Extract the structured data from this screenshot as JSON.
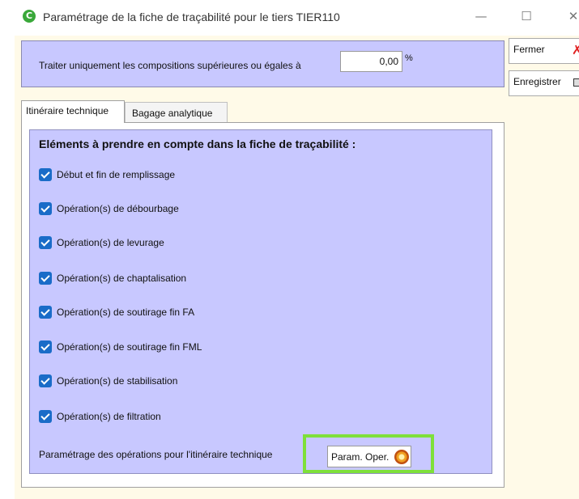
{
  "window": {
    "title": "Paramétrage de la fiche de traçabilité pour le tiers TIER110",
    "minimize": "—",
    "maximize": "☐",
    "close": "✕"
  },
  "threshold": {
    "label": "Traiter uniquement les compositions supérieures ou égales à",
    "value": "0,00",
    "unit": "%"
  },
  "buttons": {
    "close_label": "Fermer",
    "save_label": "Enregistrer",
    "close_icon": "x-icon",
    "save_icon": "save-icon"
  },
  "tabs": [
    {
      "label": "Itinéraire technique",
      "active": true
    },
    {
      "label": "Bagage analytique",
      "active": false
    }
  ],
  "section": {
    "title": "Eléments à prendre en compte dans la fiche de traçabilité :",
    "items": [
      {
        "label": "Début et fin de remplissage",
        "checked": true
      },
      {
        "label": "Opération(s)  de débourbage",
        "checked": true
      },
      {
        "label": "Opération(s)  de levurage",
        "checked": true
      },
      {
        "label": "Opération(s)  de chaptalisation",
        "checked": true
      },
      {
        "label": "Opération(s)  de soutirage fin FA",
        "checked": true
      },
      {
        "label": "Opération(s)  de soutirage fin FML",
        "checked": true
      },
      {
        "label": "Opération(s)  de stabilisation",
        "checked": true
      },
      {
        "label": "Opération(s)  de filtration",
        "checked": true
      }
    ]
  },
  "param": {
    "label": "Paramétrage des opérations pour l'itinéraire technique",
    "button_label": "Param. Oper.",
    "highlight_color": "#7ee03a"
  },
  "colors": {
    "panel": "#c8c8ff",
    "checkbox": "#1a6cc8",
    "client_bg": "#fffae8"
  }
}
